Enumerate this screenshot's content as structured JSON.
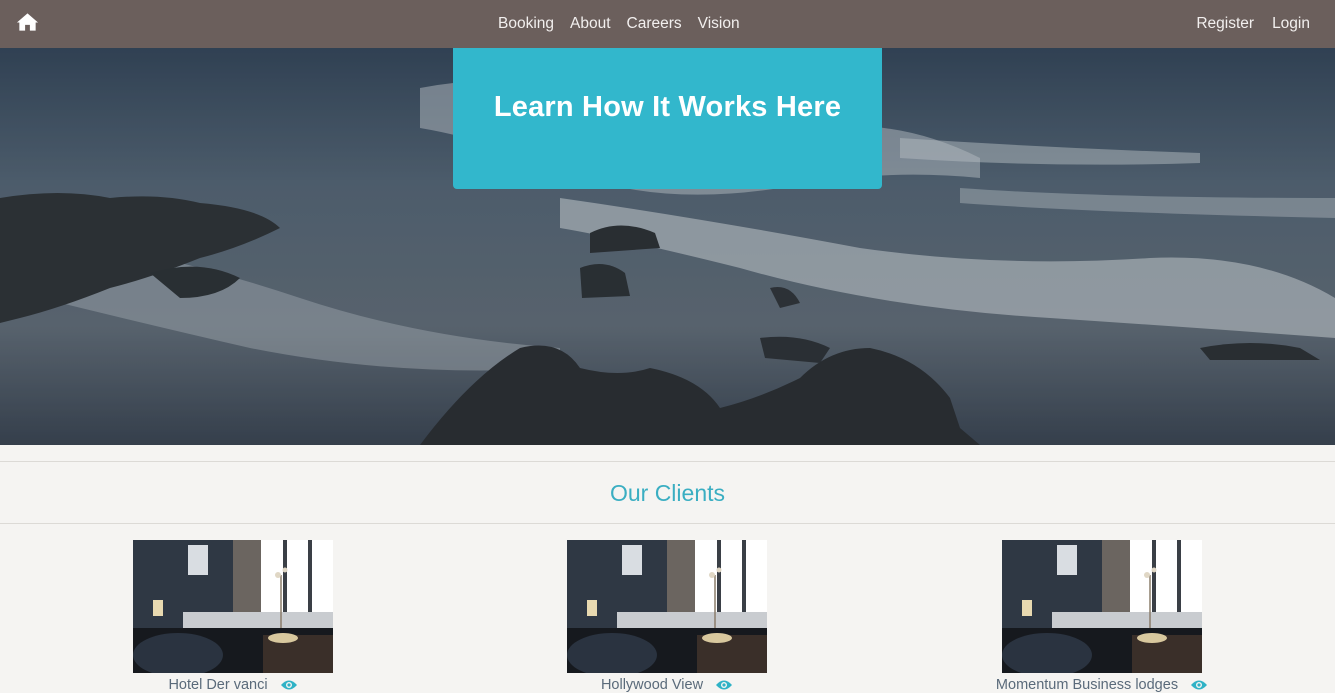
{
  "nav": {
    "home_icon": "home-icon",
    "links": [
      "Booking",
      "About",
      "Careers",
      "Vision"
    ],
    "auth": [
      "Register",
      "Login"
    ]
  },
  "hero": {
    "cta_label": "Learn How It Works Here"
  },
  "clients": {
    "title": "Our Clients",
    "items": [
      {
        "name": "Hotel Der vanci",
        "icon": "eye-icon"
      },
      {
        "name": "Hollywood View",
        "icon": "eye-icon"
      },
      {
        "name": "Momentum Business lodges",
        "icon": "eye-icon"
      }
    ]
  },
  "colors": {
    "navbar": "#6b5f5c",
    "accent": "#32b7cc",
    "page_bg": "#f5f4f2"
  }
}
